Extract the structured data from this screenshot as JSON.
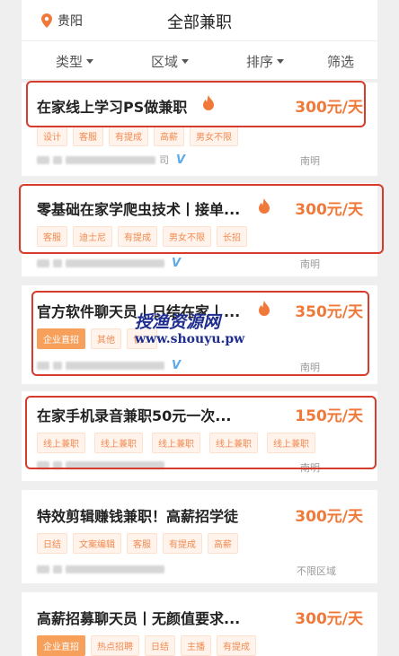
{
  "header": {
    "city": "贵阳",
    "title": "全部兼职"
  },
  "filters": [
    "类型",
    "区域",
    "排序",
    "筛选"
  ],
  "jobs": [
    {
      "title": "在家线上学习PS做兼职",
      "price": "300元/天",
      "tags": [
        "设计",
        "客服",
        "有提成",
        "高薪",
        "男女不限"
      ],
      "location": "南明",
      "company_suffix": "司"
    },
    {
      "title": "零基础在家学爬虫技术丨接单...",
      "price": "300元/天",
      "tags": [
        "客服",
        "迪士尼",
        "有提成",
        "男女不限",
        "长招"
      ],
      "location": "南明"
    },
    {
      "title": "官方软件聊天员丨日结在家丨...",
      "price": "350元/天",
      "tags": [
        "企业直招",
        "其他",
        "包..."
      ],
      "location": "南明"
    },
    {
      "title": "在家手机录音兼职50元一次...",
      "price": "150元/天",
      "tags": [
        "线上兼职",
        "线上兼职",
        "线上兼职",
        "线上兼职",
        "线上兼职"
      ],
      "location": "南明"
    },
    {
      "title": "特效剪辑赚钱兼职！高薪招学徒",
      "price": "300元/天",
      "tags": [
        "日结",
        "文案编辑",
        "客服",
        "有提成",
        "高薪"
      ],
      "location": "不限区域"
    },
    {
      "title": "高薪招募聊天员丨无颜值要求...",
      "price": "300元/天",
      "tags": [
        "企业直招",
        "热点招聘",
        "日结",
        "主播",
        "有提成"
      ]
    }
  ],
  "watermark": {
    "line1": "授渔资源网",
    "line2": "www.shouyu.pw"
  },
  "colors": {
    "accent": "#f0793a",
    "annotation": "#d63b2c"
  }
}
